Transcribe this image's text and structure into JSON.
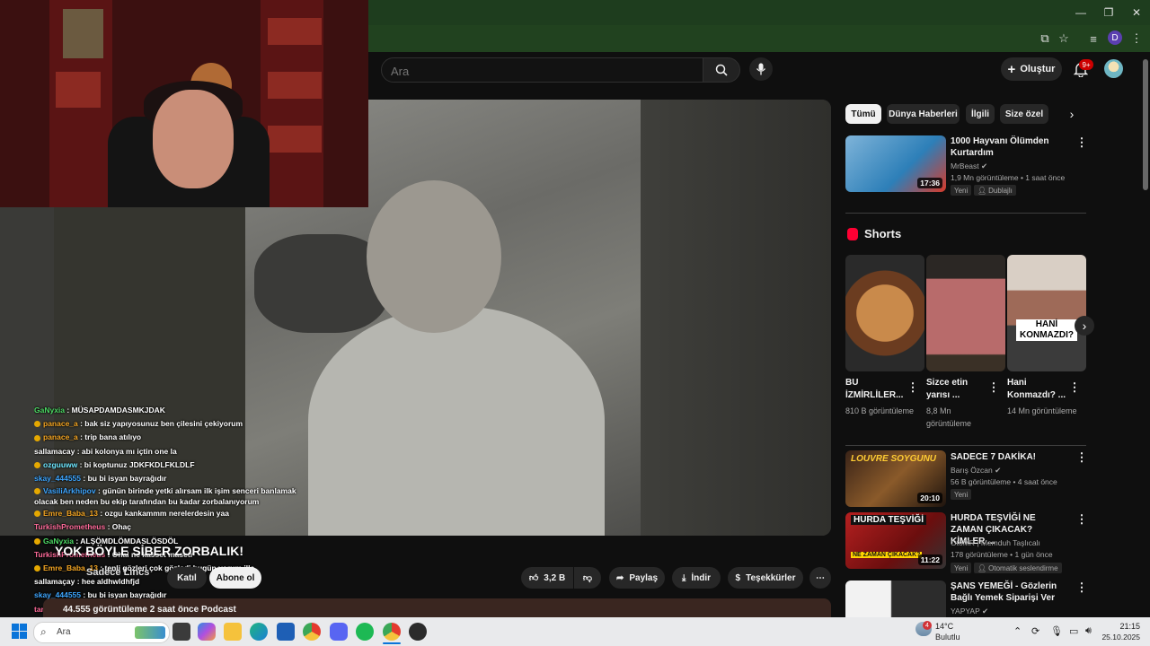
{
  "browser": {
    "profile_initial": "D",
    "window_controls": {
      "minimize": "—",
      "restore": "❐",
      "close": "✕"
    }
  },
  "header": {
    "search_placeholder": "Ara",
    "create_label": "Oluştur",
    "notifications_badge": "9+"
  },
  "webcam_chat": {
    "messages": [
      {
        "user": "GaNyxia",
        "text": "MÜSAPDAMDASMKJDAK",
        "user_color": "#4cd964",
        "badge": false
      },
      {
        "user": "panace_a",
        "text": "bak siz yapıyosunuz ben çilesini çekiyorum",
        "user_color": "#f5a623",
        "badge": true
      },
      {
        "user": "panace_a",
        "text": "trip bana atılıyo",
        "user_color": "#f5a623",
        "badge": true
      },
      {
        "user": "sallamacay",
        "text": "abi kolonya mı içtin one la",
        "user_color": "#ffffff",
        "badge": false
      },
      {
        "user": "ozguuww",
        "text": "bi koptunuz JDKFKDLFKLDLF",
        "user_color": "#6ee7ff",
        "badge": true
      },
      {
        "user": "skay_444555",
        "text": "bu bi isyan bayrağıdır",
        "user_color": "#3ea6ff",
        "badge": false
      },
      {
        "user": "VasiliArkhipov",
        "text": "günün birinde yetki alırsam ilk işim senceri banlamak olacak ben neden bu ekip tarafından bu kadar zorbalanıyorum",
        "user_color": "#3ea6ff",
        "badge": true,
        "wrap": true
      },
      {
        "user": "Emre_Baba_13",
        "text": "ozgu kankammm nerelerdesin yaa",
        "user_color": "#f5a623",
        "badge": true
      },
      {
        "user": "TurkishPrometheus",
        "text": "Ohaç",
        "user_color": "#ff6b9a",
        "badge": false
      },
      {
        "user": "GaNyxia",
        "text": "ALŞÖMDLÖMDASLÖSDÖL",
        "user_color": "#4cd964",
        "badge": true
      },
      {
        "user": "TurkishPrometheus",
        "text": "Ohal ne kasset masetr",
        "user_color": "#ff6b9a",
        "badge": false
      },
      {
        "user": "Emre_Baba_13",
        "text": "tenli gözleri çok gözledi bugün yorum illa",
        "user_color": "#f5a623",
        "badge": true
      },
      {
        "user": "sallamaçay",
        "text": "hee aldhwldhfjd",
        "user_color": "#ffffff",
        "badge": false
      },
      {
        "user": "skay_444555",
        "text": "bu bi isyan bayrağıdır",
        "user_color": "#3ea6ff",
        "badge": false
      },
      {
        "user": "tarcine",
        "text": "gülsünüze 2 saat önce",
        "user_color": "#ff6b9a",
        "badge": false
      }
    ]
  },
  "video": {
    "title": "YOK BÖYLE SİBER ZORBALIK!",
    "channel": "Sadece Lincs",
    "join_label": "Katıl",
    "subscribe_label": "Abone ol",
    "like_count": "3,2 B",
    "share_label": "Paylaş",
    "download_label": "İndir",
    "thanks_label": "Teşekkürler",
    "description_meta": "44.555 görüntüleme  2 saat önce  Podcast"
  },
  "chips": [
    "Tümü",
    "Dünya Haberleri",
    "İlgili",
    "Size özel"
  ],
  "recommendations": [
    {
      "title": "1000 Hayvanı Ölümden Kurtardım",
      "channel": "MrBeast",
      "views_time": "1,9 Mn görüntüleme • 1 saat önce",
      "duration": "17:36",
      "badges": [
        "Yeni",
        "Dublajlı"
      ],
      "verified": true
    },
    {
      "title": "SADECE 7 DAKİKA!",
      "channel": "Barış Özcan",
      "views_time": "56 B görüntüleme • 4 saat önce",
      "duration": "20:10",
      "badges": [
        "Yeni"
      ],
      "verified": true,
      "thumb_text": "LOUVRE SOYGUNU"
    },
    {
      "title": "HURDA TEŞVİĞİ NE ZAMAN ÇIKACAK? KİMLER ...",
      "channel": "OtoMR | Memduh Taşlıcalı",
      "views_time": "178 görüntüleme • 1 gün önce",
      "duration": "11:22",
      "badges": [
        "Yeni",
        "Otomatik seslendirme"
      ],
      "verified": false,
      "thumb_text": "HURDA TEŞVİĞİ",
      "thumb_sub": "NE ZAMAN ÇIKACAK?"
    },
    {
      "title": "ŞANS YEMEĞİ - Gözlerin Bağlı Yemek Siparişi Ver",
      "channel": "YAPYAP",
      "views_time": "",
      "duration": "",
      "badges": [],
      "verified": true
    }
  ],
  "shorts": {
    "heading": "Shorts",
    "items": [
      {
        "title": "BU İZMİRLİLER...",
        "views": "810 B görüntüleme"
      },
      {
        "title": "Sizce etin yarısı ...",
        "views": "8,8 Mn görüntüleme"
      },
      {
        "title": "Hani Konmazdı? ...",
        "views": "14 Mn görüntüleme",
        "thumb_text": "HANİ KONMAZDI?"
      }
    ]
  },
  "taskbar": {
    "search_placeholder": "Ara",
    "weather_temp": "14°C",
    "weather_desc": "Bulutlu",
    "weather_badge": "4",
    "time": "21:15",
    "date": "25.10.2025"
  }
}
